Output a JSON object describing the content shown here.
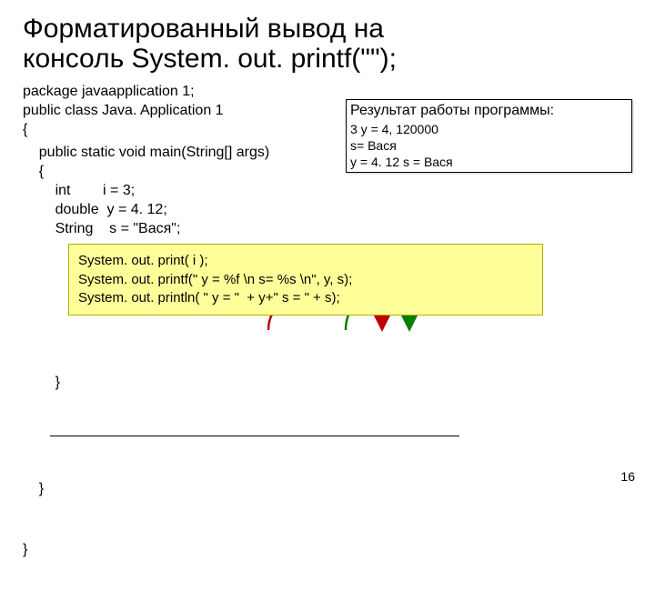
{
  "title": "Форматированный вывод на\nконсоль System. out. printf(\"\");",
  "code_top": "package javaapplication 1;\npublic class Java. Application 1\n{",
  "result": {
    "header": "Результат работы программы:",
    "line1": "3 y = 4, 120000",
    "line2": " s= Вася",
    "line3": " y = 4. 12 s = Вася"
  },
  "code_main": "    public static void main(String[] args)\n    {\n        int        i = 3;\n        double  y = 4. 12;\n        String    s = \"Вася\";",
  "highlight": "System. out. print( i );\nSystem. out. printf(\" y = %f \\n s= %s \\n\", y, s);\nSystem. out. println( \" y = \"  + y+\" s = \" + s);",
  "closing_inner": "        }",
  "closing_mid": "    }",
  "closing_outer": "}",
  "page_num": "16"
}
